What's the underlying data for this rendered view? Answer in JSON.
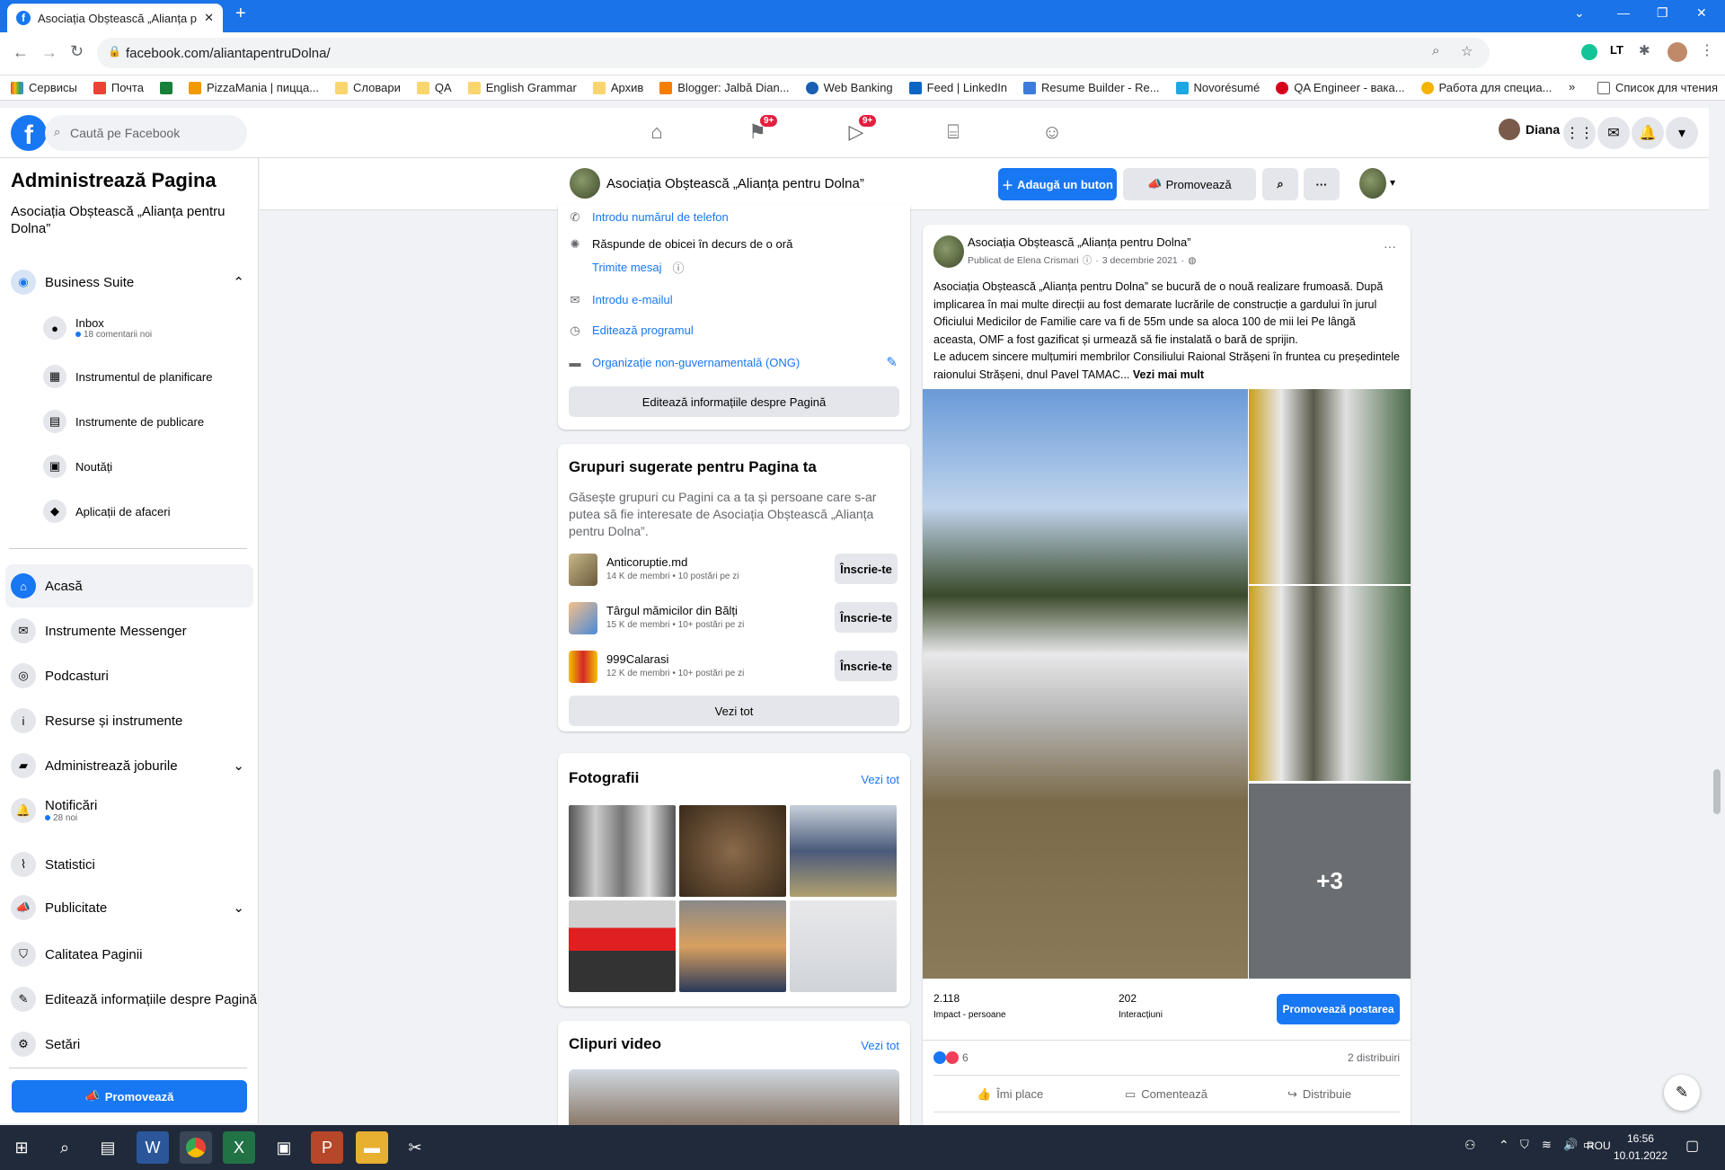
{
  "browser": {
    "tab_title": "Asociația Obștească „Alianța pe",
    "url": "facebook.com/aliantapentruDolna/",
    "bookmarks": [
      "Сервисы",
      "Почта",
      "PizzaMania | пицца...",
      "Словари",
      "QA",
      "English Grammar",
      "Архив",
      "Blogger: Jalbă Dian...",
      "Web Banking",
      "Feed | LinkedIn",
      "Resume Builder - Re...",
      "Novorésumé",
      "QA Engineer - вака...",
      "Работа для специа..."
    ],
    "more_bookmarks": "»",
    "reading_list": "Список для чтения"
  },
  "fb": {
    "search_placeholder": "Caută pe Facebook",
    "badge_1": "9+",
    "badge_2": "9+",
    "user_name": "Diana"
  },
  "sidebar": {
    "title": "Administrează Pagina",
    "page_name": "Asociația Obștească „Alianța pentru Dolna”",
    "business_suite": "Business Suite",
    "sub_items": [
      {
        "label": "Inbox",
        "note": "18 comentarii noi"
      },
      {
        "label": "Instrumentul de planificare"
      },
      {
        "label": "Instrumente de publicare"
      },
      {
        "label": "Noutăți"
      },
      {
        "label": "Aplicații de afaceri"
      }
    ],
    "items": [
      {
        "label": "Acasă"
      },
      {
        "label": "Instrumente Messenger"
      },
      {
        "label": "Podcasturi"
      },
      {
        "label": "Resurse și instrumente"
      },
      {
        "label": "Administrează joburile"
      },
      {
        "label": "Notificări",
        "note": "28 noi"
      },
      {
        "label": "Statistici"
      },
      {
        "label": "Publicitate"
      },
      {
        "label": "Calitatea Paginii"
      },
      {
        "label": "Editează informațiile despre Pagină"
      },
      {
        "label": "Setări"
      }
    ],
    "promote": "Promovează"
  },
  "page_header": {
    "name": "Asociația Obștească „Alianța pentru Dolna”",
    "add_button": "Adaugă un buton",
    "promote": "Promovează"
  },
  "about": {
    "phone": "Introdu numărul de telefon",
    "response": "Răspunde de obicei în decurs de o oră",
    "send_message": "Trimite mesaj",
    "email": "Introdu e-mailul",
    "schedule": "Editează programul",
    "category": "Organizație non-guvernamentală (ONG)",
    "edit_info": "Editează informațiile despre Pagină"
  },
  "groups": {
    "title": "Grupuri sugerate pentru Pagina ta",
    "description": "Găsește grupuri cu Pagini ca a ta și persoane care s-ar putea să fie interesate de Asociația Obștească „Alianța pentru Dolna”.",
    "list": [
      {
        "name": "Anticoruptie.md",
        "meta": "14 K de membri • 10 postări pe zi",
        "join": "Înscrie-te"
      },
      {
        "name": "Târgul mămicilor din Bălți",
        "meta": "15 K de membri • 10+ postări pe zi",
        "join": "Înscrie-te"
      },
      {
        "name": "999Calarasi",
        "meta": "12 K de membri • 10+ postări pe zi",
        "join": "Înscrie-te"
      }
    ],
    "see_all": "Vezi tot"
  },
  "photos": {
    "title": "Fotografii",
    "see_all": "Vezi tot"
  },
  "videos": {
    "title": "Clipuri video",
    "see_all": "Vezi tot"
  },
  "post": {
    "author": "Asociația Obștească „Alianța pentru Dolna”",
    "meta": "Publicat de Elena Crismari",
    "date": "3 decembrie 2021",
    "text": "Asociația Obștească „Alianța pentru Dolna” se bucură de o nouă realizare frumoasă. După implicarea în mai multe direcții au fost demarate lucrările de construcție a  gardului în jurul Oficiului Medicilor de Familie care va fi de  55m unde sa aloca 100 de mii  lei Pe lângă aceasta, OMF a fost gazificat și urmează să fie instalată o bară de sprijin.",
    "text2": "Le aducem sincere mulțumiri membrilor Consiliului Raional Strășeni în fruntea cu președintele raionului Strășeni, dnul Pavel TAMAC...",
    "see_more": "Vezi mai mult",
    "more_photos": "+3",
    "reach": "2.118",
    "reach_label": "Impact - persoane",
    "engagement": "202",
    "engagement_label": "Interacțiuni",
    "promote_post": "Promovează postarea",
    "reactions": "6",
    "shares": "2 distribuiri",
    "like": "Îmi place",
    "comment": "Comentează",
    "share": "Distribuie"
  },
  "taskbar": {
    "lang": "ROU",
    "time": "16:56",
    "date": "10.01.2022"
  },
  "colors": {
    "primary": "#1877f2",
    "chrome_blue": "#1a73e8",
    "taskbar": "#202a3a"
  }
}
